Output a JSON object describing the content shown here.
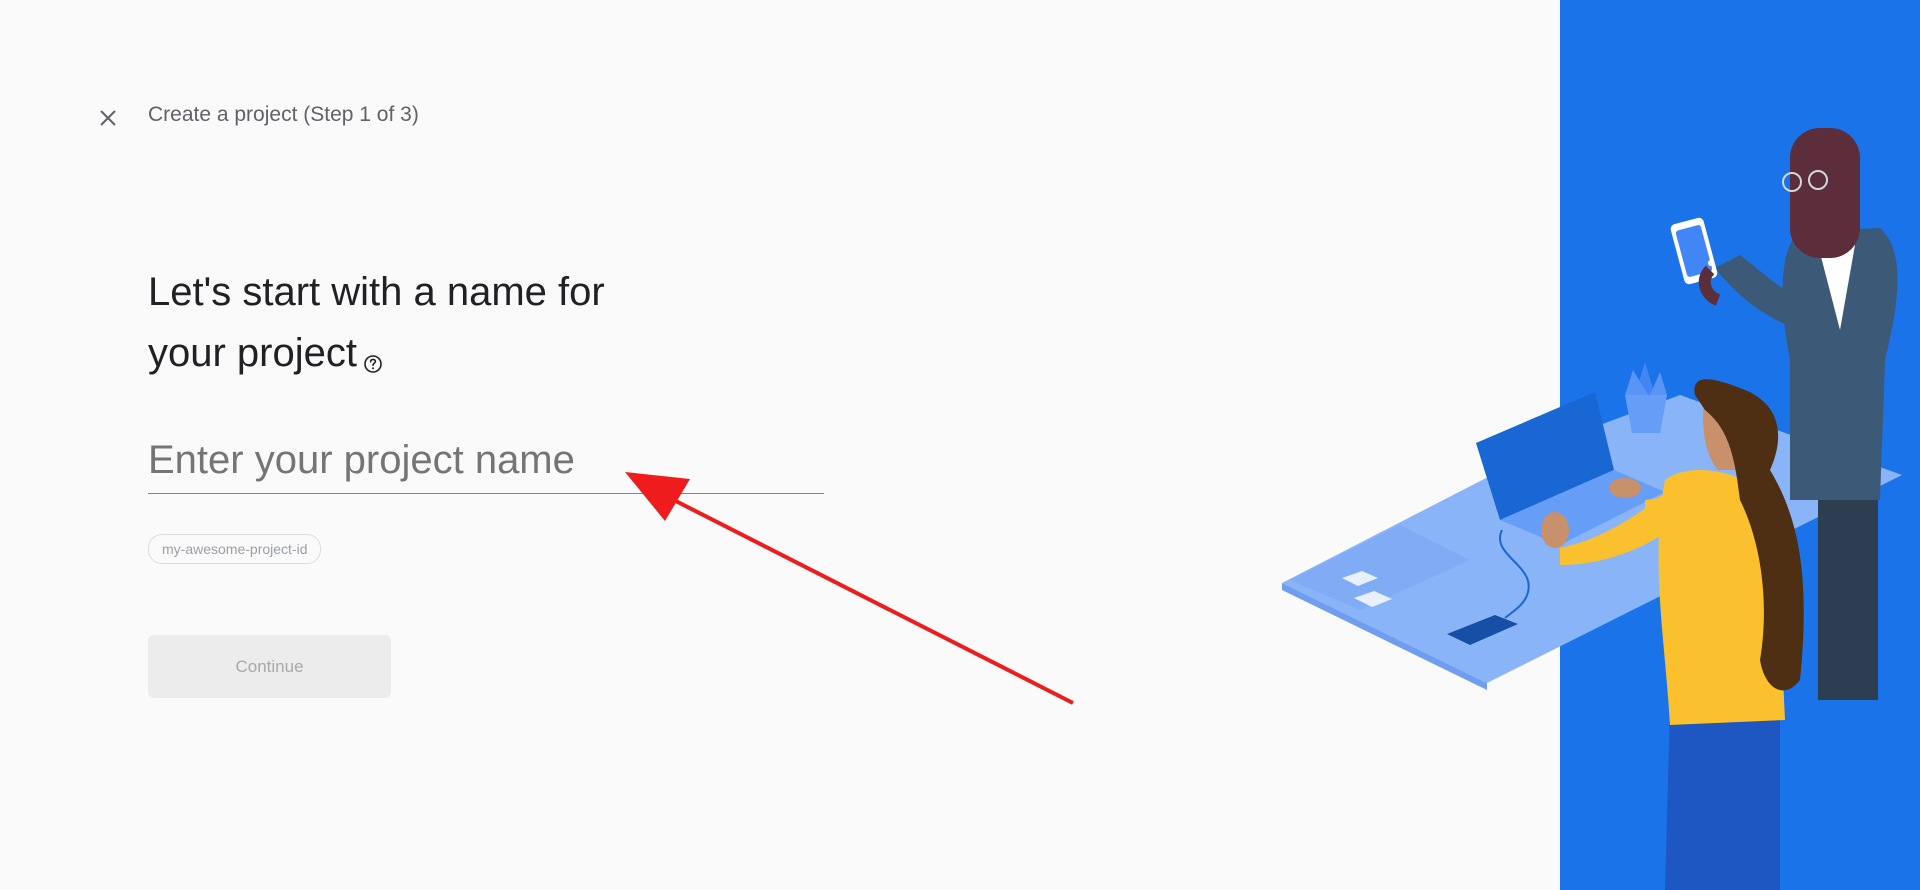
{
  "header": {
    "close_icon": "close-icon",
    "step_title": "Create a project (Step 1 of 3)"
  },
  "main": {
    "heading_line1": "Let's start with a name for",
    "heading_line2": "your project",
    "help_icon": "help-circle-icon",
    "project_name_input": {
      "value": "",
      "placeholder": "Enter your project name"
    },
    "project_id_chip": "my-awesome-project-id",
    "continue_label": "Continue"
  },
  "colors": {
    "accent_blue": "#1a73e8",
    "annotation_arrow": "#ff0000"
  }
}
